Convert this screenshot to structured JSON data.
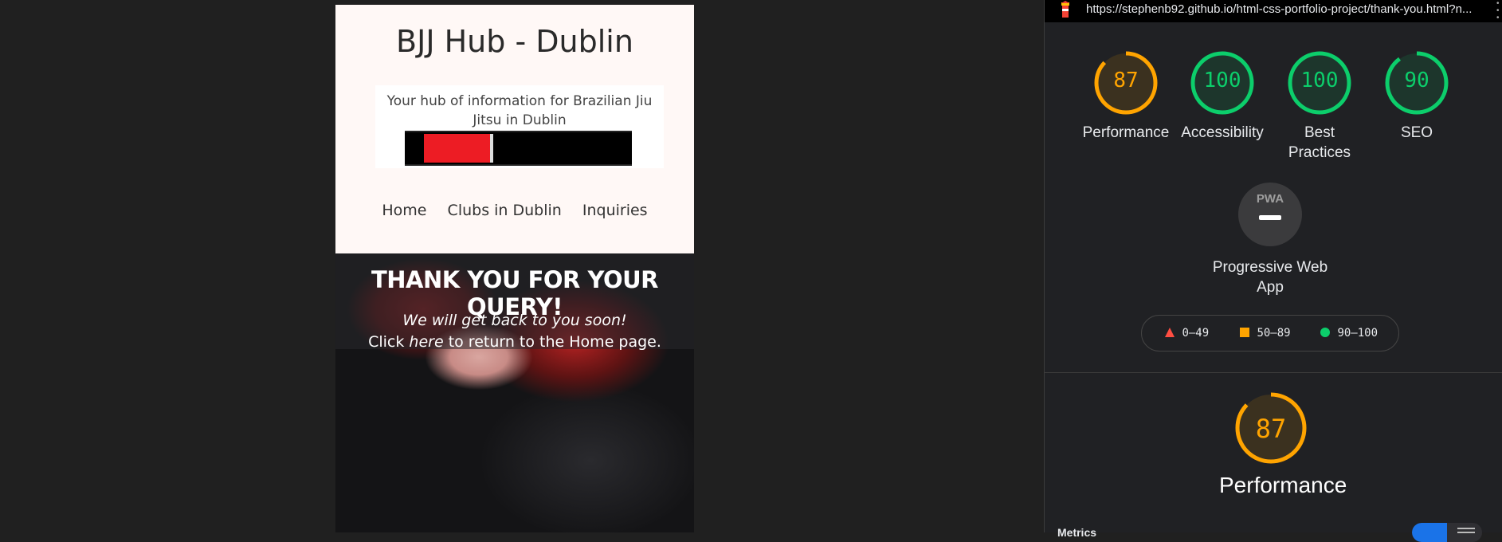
{
  "site": {
    "title": "BJJ Hub - Dublin",
    "tagline": "Your hub of information for Brazilian Jiu Jitsu in Dublin",
    "nav": [
      "Home",
      "Clubs in Dublin",
      "Inquiries"
    ],
    "hero": {
      "heading": "THANK YOU FOR YOUR QUERY!",
      "subheading": "We will get back to you soon!",
      "return_prefix": "Click",
      "return_link": "here",
      "return_suffix": "to return to the Home page."
    }
  },
  "lighthouse": {
    "url": "https://stephenb92.github.io/html-css-portfolio-project/thank-you.html?n...",
    "scores": [
      {
        "label": "Performance",
        "value": 87,
        "color": "#ffa400"
      },
      {
        "label": "Accessibility",
        "value": 100,
        "color": "#0cce6b"
      },
      {
        "label": "Best Practices",
        "value": 100,
        "color": "#0cce6b"
      },
      {
        "label": "SEO",
        "value": 90,
        "color": "#0cce6b"
      }
    ],
    "pwa": {
      "badge": "PWA",
      "label": "Progressive Web App"
    },
    "legend": [
      {
        "range": "0–49",
        "color": "#ff4e42",
        "shape": "triangle"
      },
      {
        "range": "50–89",
        "color": "#ffa400",
        "shape": "square"
      },
      {
        "range": "90–100",
        "color": "#0cce6b",
        "shape": "circle"
      }
    ],
    "performance_detail": {
      "value": 87,
      "label": "Performance"
    },
    "metrics_label": "Metrics"
  }
}
